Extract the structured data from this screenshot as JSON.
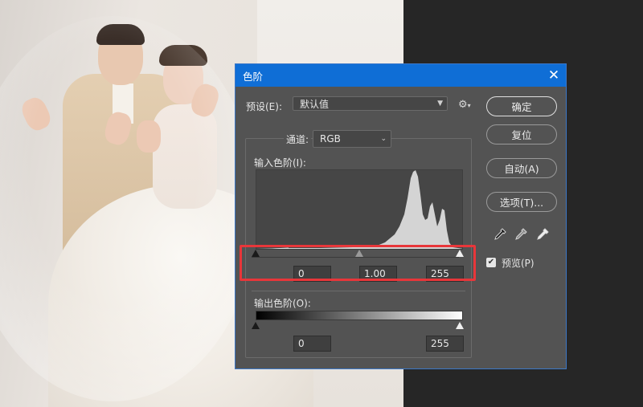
{
  "dialog": {
    "title": "色阶",
    "close_icon": "close-icon"
  },
  "preset": {
    "label": "预设(E):",
    "value": "默认值"
  },
  "channel": {
    "label": "通道:",
    "value": "RGB"
  },
  "input_levels": {
    "label": "输入色阶(I):",
    "black": "0",
    "gamma": "1.00",
    "white": "255"
  },
  "output_levels": {
    "label": "输出色阶(O):",
    "black": "0",
    "white": "255"
  },
  "buttons": {
    "ok": "确定",
    "reset": "复位",
    "auto": "自动(A)",
    "options": "选项(T)..."
  },
  "preview": {
    "label": "预览(P)",
    "checked": true
  },
  "icons": [
    "close-icon",
    "gear-icon",
    "black-eyedropper-icon",
    "gray-eyedropper-icon",
    "white-eyedropper-icon",
    "check-icon",
    "chevron-down-icon"
  ],
  "colors": {
    "titlebar": "#0f6ed6",
    "dialog_bg": "#535353",
    "highlight": "#e8363a"
  }
}
